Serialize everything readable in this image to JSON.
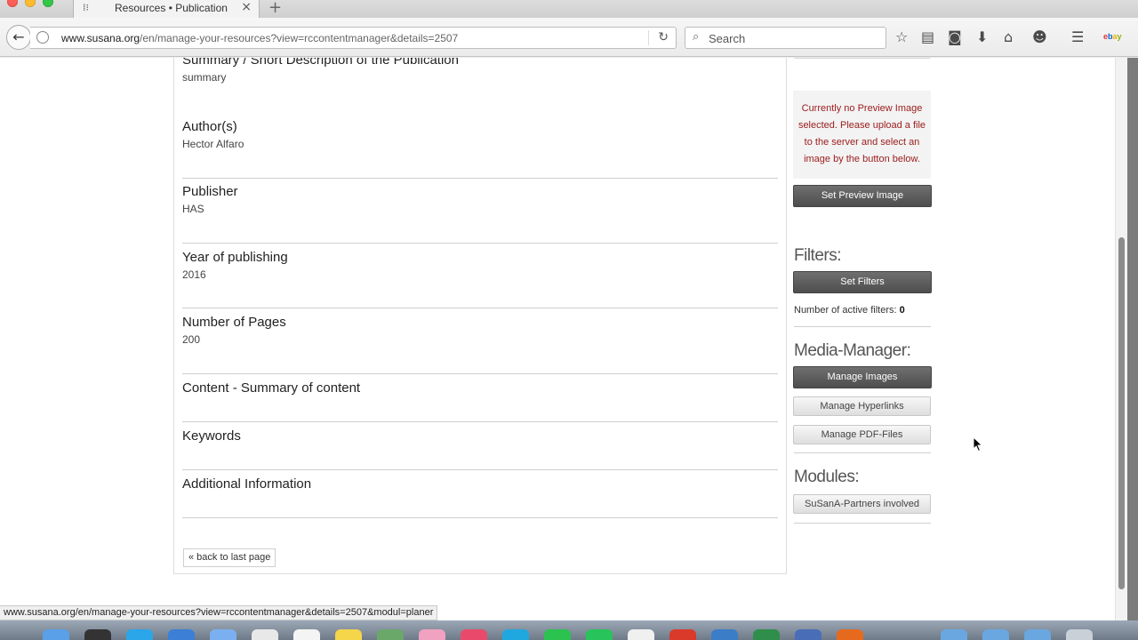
{
  "browser": {
    "tab_title": "Resources • Publication",
    "url_domain": "www.susana.org",
    "url_path": "/en/manage-your-resources?view=rccontentmanager&details=2507",
    "search_placeholder": "Search",
    "status_url": "www.susana.org/en/manage-your-resources?view=rccontentmanager&details=2507&modul=planer"
  },
  "fields": [
    {
      "label": "Summary / Short Description of the Publication",
      "value": "summary"
    },
    {
      "label": "Author(s)",
      "value": "Hector Alfaro"
    },
    {
      "label": "Publisher",
      "value": "HAS"
    },
    {
      "label": "Year of publishing",
      "value": "2016"
    },
    {
      "label": "Number of Pages",
      "value": "200"
    },
    {
      "label": "Content - Summary of content",
      "value": ""
    },
    {
      "label": "Keywords",
      "value": ""
    },
    {
      "label": "Additional Information",
      "value": ""
    }
  ],
  "back_link": "« back to last page",
  "sidebar": {
    "preview_notice": "Currently no Preview Image selected. Please upload a file to the server and select an image by the button below.",
    "set_preview_label": "Set Preview Image",
    "filters_heading": "Filters:",
    "set_filters_label": "Set Filters",
    "active_filters_label": "Number of active filters:",
    "active_filters_count": "0",
    "media_heading": "Media-Manager:",
    "manage_images_label": "Manage Images",
    "manage_hyperlinks_label": "Manage Hyperlinks",
    "manage_pdf_label": "Manage PDF-Files",
    "modules_heading": "Modules:",
    "partners_label": "SuSanA-Partners involved"
  },
  "icons": {
    "bookmark_star": "star-icon",
    "reading_list": "clipboard-icon",
    "pocket": "pocket-icon",
    "downloads": "download-icon",
    "home": "home-icon",
    "chat": "chat-icon",
    "menu": "hamburger-icon"
  }
}
